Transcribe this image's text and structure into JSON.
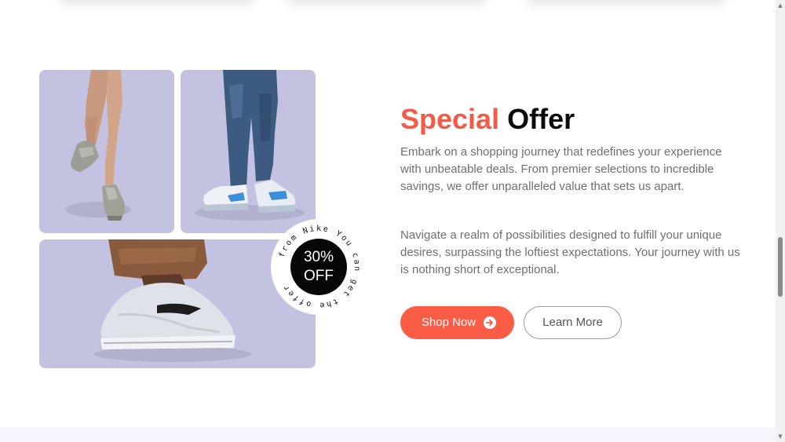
{
  "offer": {
    "heading_accent": "Special",
    "heading_rest": "Offer",
    "paragraph_1": "Embark on a shopping journey that redefines your experience with unbeatable deals. From premier selections to incredible savings, we offer unparalleled value that sets us apart.",
    "paragraph_2": "Navigate a realm of possibilities designed to fulfill your unique desires, surpassing the loftiest expectations. Your journey with us is nothing short of exceptional.",
    "shop_label": "Shop Now",
    "learn_label": "Learn More"
  },
  "badge": {
    "percent": "30%",
    "off": "OFF",
    "ring_text": "from Nike You can get the offer"
  },
  "icons": {
    "shop_button_icon": "arrow-right-circle-icon",
    "scroll_up": "triangle-up-icon",
    "scroll_down": "triangle-down-icon"
  },
  "colors": {
    "accent": "#f45b46",
    "button": "#fa5c45",
    "tile_background": "#c3c2e0",
    "badge": "#070707",
    "text_muted": "#6f6f6f"
  }
}
